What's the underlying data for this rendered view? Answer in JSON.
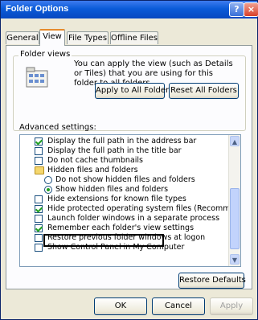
{
  "window": {
    "title": "Folder Options",
    "help_label": "?",
    "close_label": "×"
  },
  "tabs": [
    {
      "label": "General",
      "active": false
    },
    {
      "label": "View",
      "active": true
    },
    {
      "label": "File Types",
      "active": false
    },
    {
      "label": "Offline Files",
      "active": false
    }
  ],
  "folder_views": {
    "legend": "Folder views",
    "description": "You can apply the view (such as Details or Tiles) that you are using for this folder to all folders.",
    "apply_button": "Apply to All Folders",
    "reset_button": "Reset All Folders"
  },
  "advanced": {
    "label": "Advanced settings:",
    "items": [
      {
        "kind": "checkbox",
        "checked": true,
        "text": "Display the full path in the address bar"
      },
      {
        "kind": "checkbox",
        "checked": false,
        "text": "Display the full path in the title bar"
      },
      {
        "kind": "checkbox",
        "checked": false,
        "text": "Do not cache thumbnails"
      },
      {
        "kind": "folder",
        "text": "Hidden files and folders"
      },
      {
        "kind": "radio",
        "selected": false,
        "text": "Do not show hidden files and folders"
      },
      {
        "kind": "radio",
        "selected": true,
        "text": "Show hidden files and folders"
      },
      {
        "kind": "checkbox",
        "checked": false,
        "text": "Hide extensions for known file types"
      },
      {
        "kind": "checkbox",
        "checked": true,
        "text": "Hide protected operating system files (Recommended)"
      },
      {
        "kind": "checkbox",
        "checked": false,
        "text": "Launch folder windows in a separate process"
      },
      {
        "kind": "checkbox",
        "checked": true,
        "text": "Remember each folder's view settings"
      },
      {
        "kind": "checkbox",
        "checked": false,
        "text": "Restore previous folder windows at logon"
      },
      {
        "kind": "checkbox",
        "checked": false,
        "text": "Show Control Panel in My Computer"
      }
    ],
    "scroll_up": "▲",
    "scroll_down": "▼"
  },
  "restore_defaults": "Restore Defaults",
  "footer": {
    "ok": "OK",
    "cancel": "Cancel",
    "apply": "Apply"
  }
}
